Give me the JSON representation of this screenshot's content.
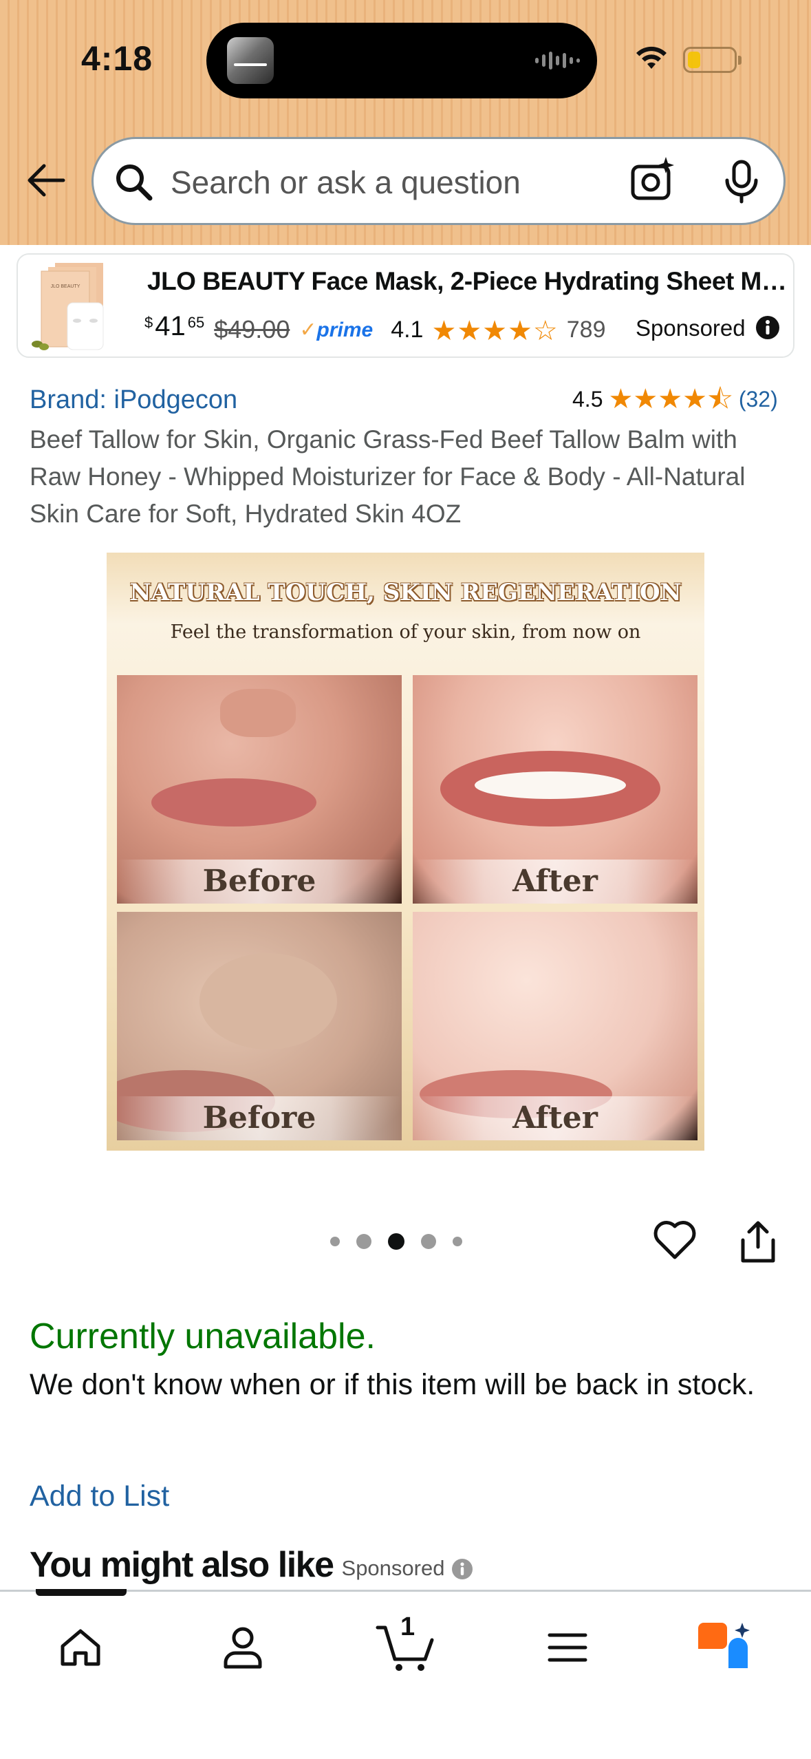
{
  "status_bar": {
    "time": "4:18"
  },
  "search": {
    "placeholder": "Search or ask a question"
  },
  "sponsored_ad": {
    "title": "JLO BEAUTY Face Mask, 2-Piece Hydrating Sheet Mask...",
    "thumb_brand": "JLO BEAUTY",
    "price_currency": "$",
    "price_whole": "41",
    "price_fraction": "65",
    "list_price": "$49.00",
    "prime_label": "prime",
    "rating": "4.1",
    "stars": "★★★★☆",
    "review_count": "789",
    "sponsored_label": "Sponsored"
  },
  "product": {
    "brand": "Brand: iPodgecon",
    "rating": "4.5",
    "stars": "★★★★⯪",
    "review_count": "(32)",
    "title": "Beef Tallow for Skin, Organic Grass-Fed Beef Tallow Balm with Raw Honey - Whipped Moisturizer for Face & Body - All-Natural Skin Care for Soft, Hydrated Skin 4OZ"
  },
  "product_image": {
    "headline": "NATURAL TOUCH, SKIN REGENERATION",
    "subline": "Feel the transformation of your skin, from now on",
    "captions": [
      "Before",
      "After",
      "Before",
      "After"
    ]
  },
  "carousel": {
    "active_index": 3,
    "total": 5
  },
  "availability": {
    "status": "Currently unavailable.",
    "message": "We don't know when or if this item will be back in stock."
  },
  "actions": {
    "add_to_list": "Add to List"
  },
  "recommendations": {
    "title": "You might also like",
    "sponsored_label": "Sponsored"
  },
  "bottom_nav": {
    "cart_count": "1",
    "items": [
      "home",
      "account",
      "cart",
      "menu",
      "rufus"
    ]
  },
  "colors": {
    "header_bg": "#f0c08c",
    "link": "#2162a1",
    "unavailable": "#007600",
    "star": "#f08804",
    "prime": "#1a73e8",
    "rufus_orange": "#ff6a13",
    "rufus_blue": "#1a8cff"
  }
}
